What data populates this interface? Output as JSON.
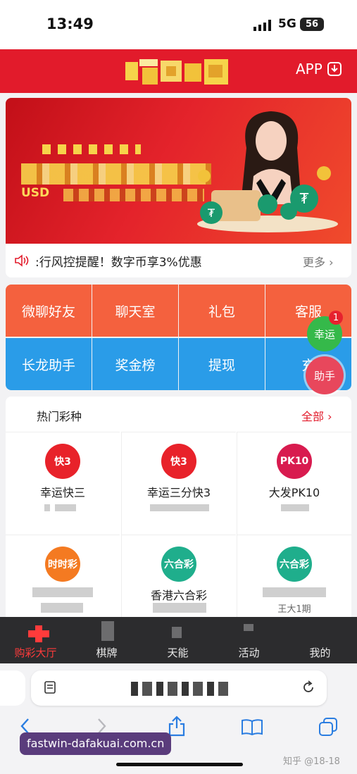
{
  "status_bar": {
    "time": "13:49",
    "network": "5G",
    "battery": "56"
  },
  "header": {
    "app_label": "APP"
  },
  "banner": {
    "currency_label": "USD"
  },
  "notice": {
    "text": ":行风控提醒！数字币享3%优惠",
    "more_label": "更多 ›"
  },
  "quick_menu": {
    "row1": [
      "微聊好友",
      "聊天室",
      "礼包",
      "客服"
    ],
    "row2": [
      "长龙助手",
      "奖金榜",
      "提现",
      "充"
    ]
  },
  "floating": {
    "lucky_label": "幸运",
    "lucky_badge": "1",
    "helper_label": "助手"
  },
  "hot_lottery": {
    "title": "热门彩种",
    "all_label": "全部 ›",
    "games": [
      {
        "name": "幸运快三",
        "subtitle": "",
        "icon_text": "快3",
        "icon_color": "#e8222a"
      },
      {
        "name": "幸运三分快3",
        "subtitle": "",
        "icon_text": "快3",
        "icon_color": "#e8222a"
      },
      {
        "name": "大发PK10",
        "subtitle": "",
        "icon_text": "PK10",
        "icon_color": "#d81b4f"
      },
      {
        "name": "",
        "subtitle": "",
        "icon_text": "时时彩",
        "icon_color": "#f47a21"
      },
      {
        "name": "香港六合彩",
        "subtitle": "",
        "icon_text": "六合彩",
        "icon_color": "#1fae8c"
      },
      {
        "name": "",
        "subtitle": "",
        "icon_text": "六合彩",
        "icon_color": "#1fae8c"
      }
    ],
    "last_subtitle": "王大1期"
  },
  "tab_bar": [
    {
      "label": "购彩大厅",
      "active": true
    },
    {
      "label": "棋牌",
      "active": false
    },
    {
      "label": "天能",
      "active": false
    },
    {
      "label": "活动",
      "active": false
    },
    {
      "label": "我的",
      "active": false
    }
  ],
  "browser": {
    "domain_label": "fastwin-dafakuai.com.cn",
    "watermark": "知乎 @18-18"
  },
  "colors": {
    "brand_red": "#e21b2b",
    "grid_orange": "#f4613e",
    "grid_blue": "#2a9ce8",
    "tabbar_bg": "#2c2c2e"
  }
}
